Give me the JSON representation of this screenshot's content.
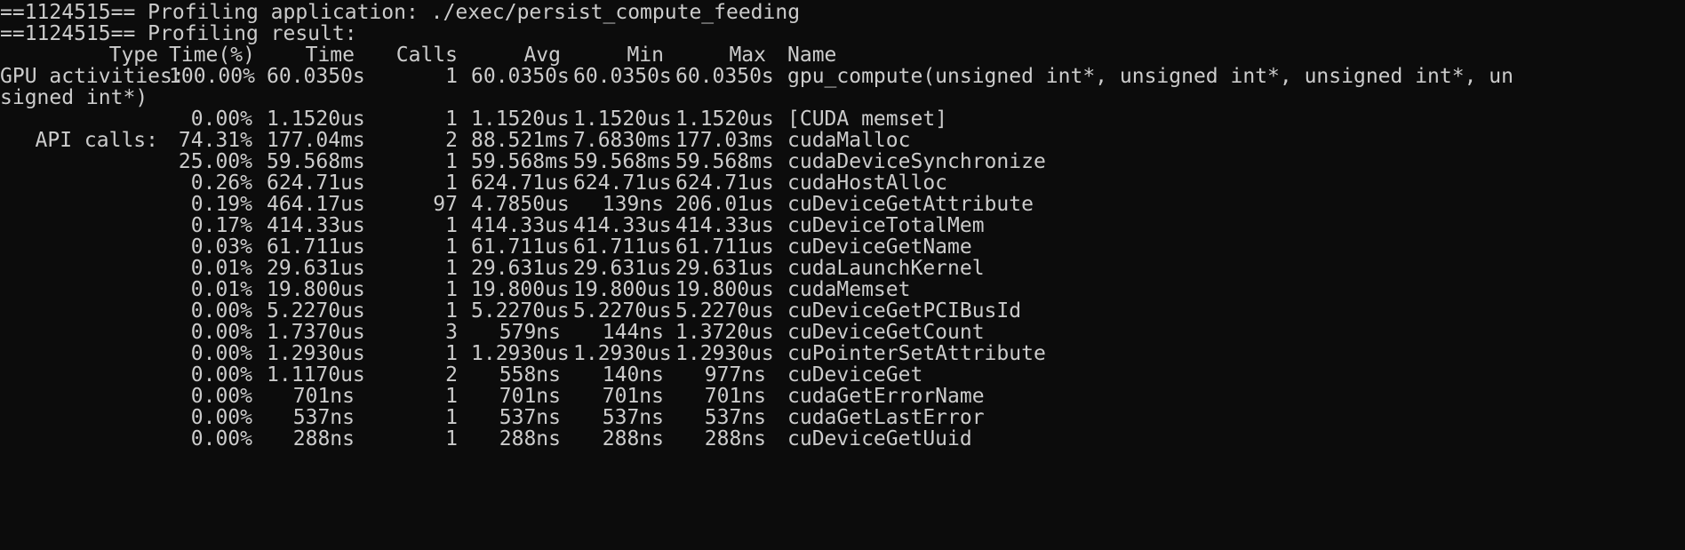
{
  "terminal": {
    "line_profiling_app": "==1124515== Profiling application: ./exec/persist_compute_feeding",
    "line_profiling_result": "==1124515== Profiling result:",
    "headers": {
      "type": "Type",
      "time_pct": "Time(%)",
      "time": "Time",
      "calls": "Calls",
      "avg": "Avg",
      "min": "Min",
      "max": "Max",
      "name": "Name"
    },
    "gpu_wrap_line": "signed int*)",
    "rows": [
      {
        "type": "GPU activities:",
        "pct": "100.00%",
        "time": "60.0350s",
        "calls": "1",
        "avg": "60.0350s",
        "min": "60.0350s",
        "max": "60.0350s",
        "name": "gpu_compute(unsigned int*, unsigned int*, unsigned int*, un"
      },
      {
        "type": "",
        "pct": "0.00%",
        "time": "1.1520us",
        "calls": "1",
        "avg": "1.1520us",
        "min": "1.1520us",
        "max": "1.1520us",
        "name": "[CUDA memset]"
      },
      {
        "type": "API calls:",
        "pct": "74.31%",
        "time": "177.04ms",
        "calls": "2",
        "avg": "88.521ms",
        "min": "7.6830ms",
        "max": "177.03ms",
        "name": "cudaMalloc"
      },
      {
        "type": "",
        "pct": "25.00%",
        "time": "59.568ms",
        "calls": "1",
        "avg": "59.568ms",
        "min": "59.568ms",
        "max": "59.568ms",
        "name": "cudaDeviceSynchronize"
      },
      {
        "type": "",
        "pct": "0.26%",
        "time": "624.71us",
        "calls": "1",
        "avg": "624.71us",
        "min": "624.71us",
        "max": "624.71us",
        "name": "cudaHostAlloc"
      },
      {
        "type": "",
        "pct": "0.19%",
        "time": "464.17us",
        "calls": "97",
        "avg": "4.7850us",
        "min": "139ns",
        "max": "206.01us",
        "name": "cuDeviceGetAttribute"
      },
      {
        "type": "",
        "pct": "0.17%",
        "time": "414.33us",
        "calls": "1",
        "avg": "414.33us",
        "min": "414.33us",
        "max": "414.33us",
        "name": "cuDeviceTotalMem"
      },
      {
        "type": "",
        "pct": "0.03%",
        "time": "61.711us",
        "calls": "1",
        "avg": "61.711us",
        "min": "61.711us",
        "max": "61.711us",
        "name": "cuDeviceGetName"
      },
      {
        "type": "",
        "pct": "0.01%",
        "time": "29.631us",
        "calls": "1",
        "avg": "29.631us",
        "min": "29.631us",
        "max": "29.631us",
        "name": "cudaLaunchKernel"
      },
      {
        "type": "",
        "pct": "0.01%",
        "time": "19.800us",
        "calls": "1",
        "avg": "19.800us",
        "min": "19.800us",
        "max": "19.800us",
        "name": "cudaMemset"
      },
      {
        "type": "",
        "pct": "0.00%",
        "time": "5.2270us",
        "calls": "1",
        "avg": "5.2270us",
        "min": "5.2270us",
        "max": "5.2270us",
        "name": "cuDeviceGetPCIBusId"
      },
      {
        "type": "",
        "pct": "0.00%",
        "time": "1.7370us",
        "calls": "3",
        "avg": "579ns",
        "min": "144ns",
        "max": "1.3720us",
        "name": "cuDeviceGetCount"
      },
      {
        "type": "",
        "pct": "0.00%",
        "time": "1.2930us",
        "calls": "1",
        "avg": "1.2930us",
        "min": "1.2930us",
        "max": "1.2930us",
        "name": "cuPointerSetAttribute"
      },
      {
        "type": "",
        "pct": "0.00%",
        "time": "1.1170us",
        "calls": "2",
        "avg": "558ns",
        "min": "140ns",
        "max": "977ns",
        "name": "cuDeviceGet"
      },
      {
        "type": "",
        "pct": "0.00%",
        "time": "701ns",
        "calls": "1",
        "avg": "701ns",
        "min": "701ns",
        "max": "701ns",
        "name": "cudaGetErrorName"
      },
      {
        "type": "",
        "pct": "0.00%",
        "time": "537ns",
        "calls": "1",
        "avg": "537ns",
        "min": "537ns",
        "max": "537ns",
        "name": "cudaGetLastError"
      },
      {
        "type": "",
        "pct": "0.00%",
        "time": "288ns",
        "calls": "1",
        "avg": "288ns",
        "min": "288ns",
        "max": "288ns",
        "name": "cuDeviceGetUuid"
      }
    ],
    "colors": {
      "background": "#0c0c0c",
      "foreground": "#cccccc",
      "prompt_green": "#16c60c",
      "prompt_blue": "#3b78ff"
    }
  }
}
